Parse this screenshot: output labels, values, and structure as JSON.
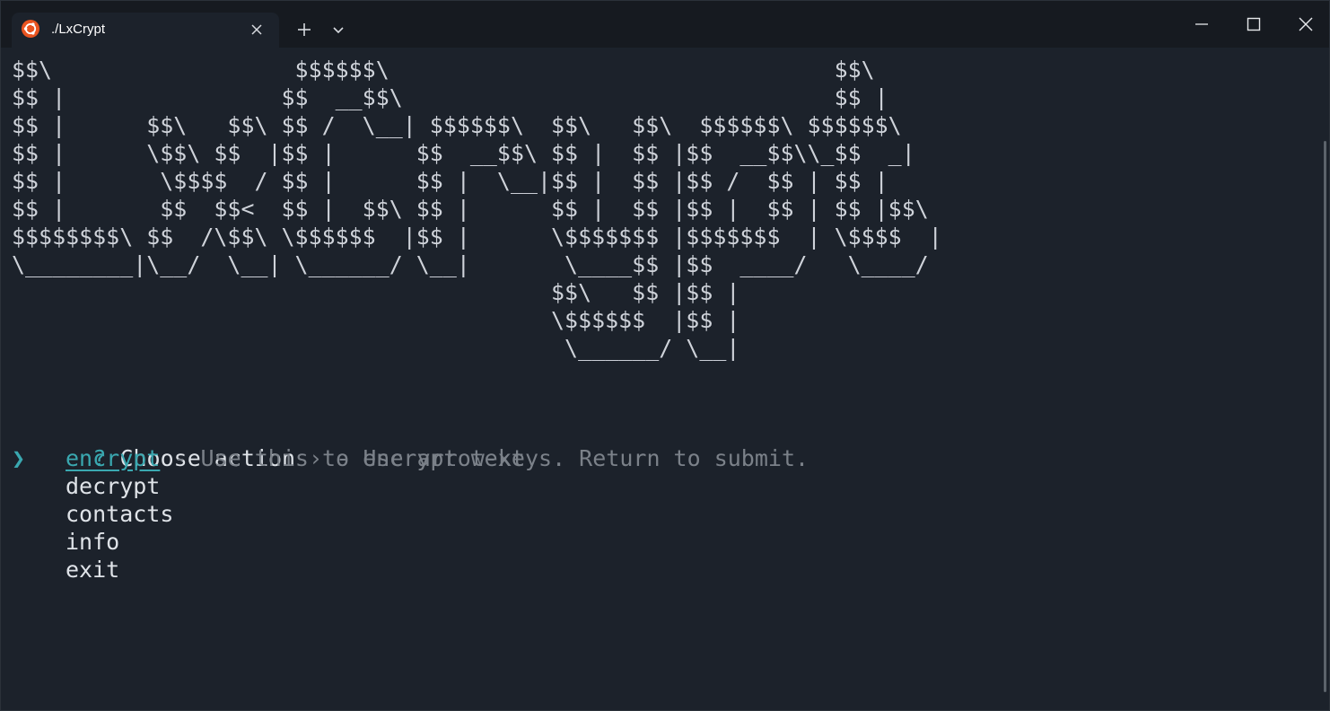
{
  "tab": {
    "title": "./LxCrypt",
    "icon": "ubuntu-icon",
    "accent": "#e95420"
  },
  "titlebar": {
    "new_tab_icon": "plus-icon",
    "dropdown_icon": "chevron-down-icon",
    "minimize_icon": "minimize-icon",
    "maximize_icon": "maximize-icon",
    "close_icon": "close-icon"
  },
  "terminal": {
    "banner": "$$\\                  $$$$$$\\                                 $$\\\n$$ |                $$  __$$\\                                $$ |\n$$ |      $$\\   $$\\ $$ /  \\__| $$$$$$\\  $$\\   $$\\  $$$$$$\\ $$$$$$\\\n$$ |      \\$$\\ $$  |$$ |      $$  __$$\\ $$ |  $$ |$$  __$$\\\\_$$  _|\n$$ |       \\$$$$  / $$ |      $$ |  \\__|$$ |  $$ |$$ /  $$ | $$ |\n$$ |       $$  $$<  $$ |  $$\\ $$ |      $$ |  $$ |$$ |  $$ | $$ |$$\\\n$$$$$$$$\\ $$  /\\$$\\ \\$$$$$$  |$$ |      \\$$$$$$$ |$$$$$$$  | \\$$$$  |\n\\________|\\__/  \\__| \\______/ \\__|       \\____$$ |$$  ____/   \\____/\n                                        $$\\   $$ |$$ |\n                                        \\$$$$$$  |$$ |\n                                         \\______/ \\__|",
    "prompt": {
      "marker": "?",
      "label": "Choose action",
      "hint": " › - Use arrow-keys. Return to submit."
    },
    "pointer": "❯",
    "options": [
      {
        "label": "encrypt",
        "description": " - Use this to encrypt text",
        "selected": true
      },
      {
        "label": "decrypt"
      },
      {
        "label": "contacts"
      },
      {
        "label": "info"
      },
      {
        "label": "exit"
      }
    ],
    "colors": {
      "accent": "#3aa8b0",
      "text": "#dfe3e8",
      "dim": "#7b8189",
      "background": "#1c222b"
    }
  }
}
